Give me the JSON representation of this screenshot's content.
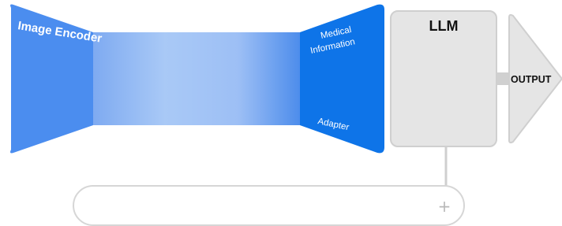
{
  "diagram": {
    "encoder": {
      "label": "Image Encoder"
    },
    "adapter": {
      "top_label_line1": "Medical",
      "top_label_line2": "Information",
      "bottom_label": "Adapter"
    },
    "llm": {
      "label": "LLM"
    },
    "output": {
      "label": "OUTPUT"
    },
    "prompt_input": {
      "value": "",
      "icon": "plus-icon",
      "glyph": "+"
    }
  },
  "colors": {
    "encoder_blue": "#4b8def",
    "adapter_blue": "#0e74e8",
    "gradient_light": "#a8c8f5",
    "gray_fill": "#e5e5e5",
    "gray_stroke": "#cfcfcf"
  }
}
